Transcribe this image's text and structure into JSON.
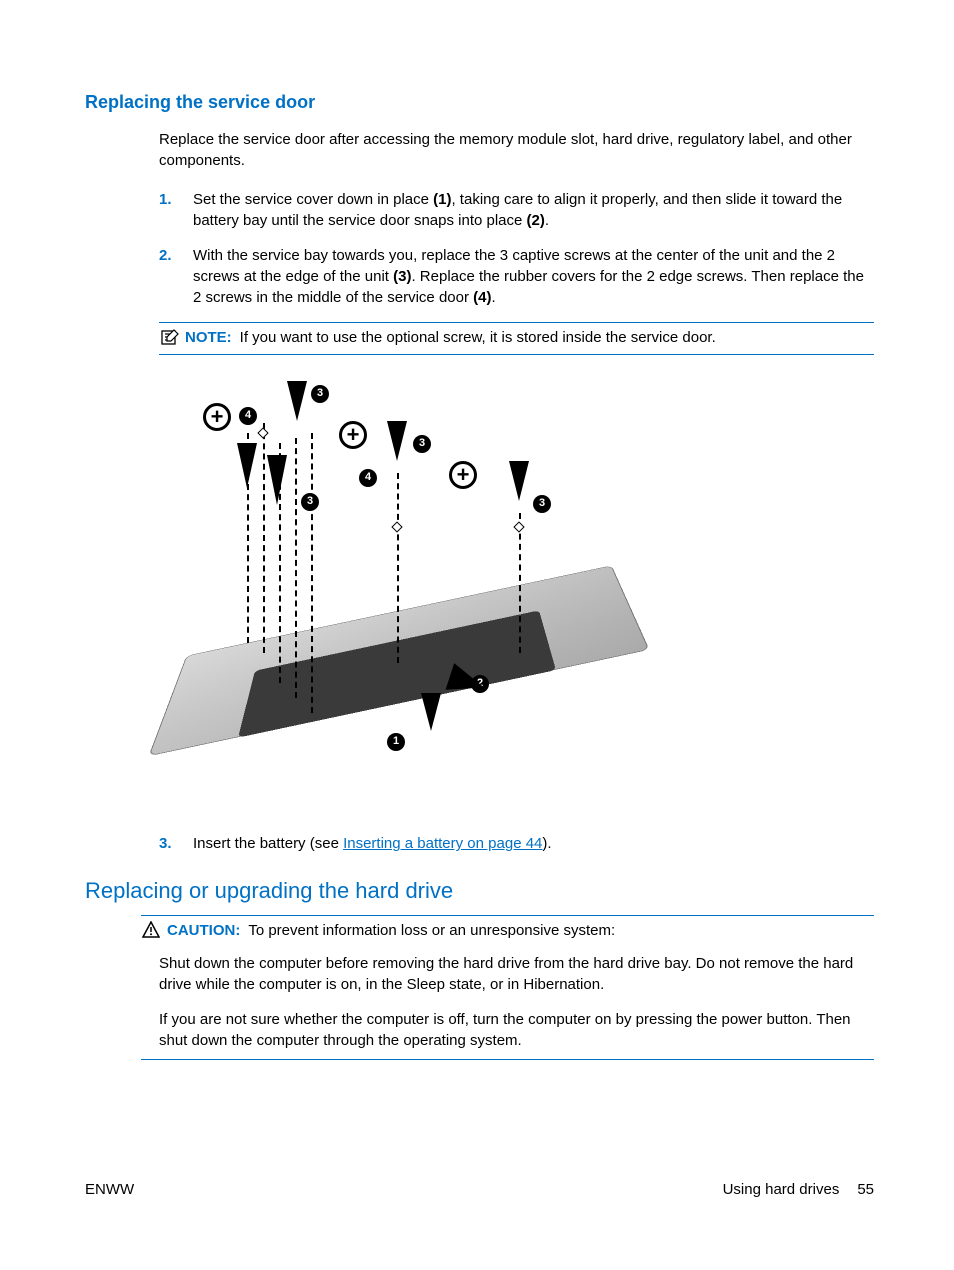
{
  "section1": {
    "heading": "Replacing the service door",
    "intro": "Replace the service door after accessing the memory module slot, hard drive, regulatory label, and other components.",
    "steps": [
      {
        "num": "1.",
        "text_a": "Set the service cover down in place ",
        "ref1": "(1)",
        "text_b": ", taking care to align it properly, and then slide it toward the battery bay until the service door snaps into place ",
        "ref2": "(2)",
        "text_c": "."
      },
      {
        "num": "2.",
        "text_a": "With the service bay towards you, replace the 3 captive screws at the center of the unit and the 2 screws at the edge of the unit ",
        "ref1": "(3)",
        "text_b": ". Replace the rubber covers for the 2 edge screws. Then replace the 2 screws in the middle of the service door ",
        "ref2": "(4)",
        "text_c": "."
      }
    ],
    "note_label": "NOTE:",
    "note_text": "If you want to use the optional screw, it is stored inside the service door.",
    "step3": {
      "num": "3.",
      "text_a": "Insert the battery (see ",
      "link": "Inserting a battery on page 44",
      "text_b": ")."
    }
  },
  "section2": {
    "heading": "Replacing or upgrading the hard drive",
    "caution_label": "CAUTION:",
    "caution_lead": "To prevent information loss or an unresponsive system:",
    "para1": "Shut down the computer before removing the hard drive from the hard drive bay. Do not remove the hard drive while the computer is on, in the Sleep state, or in Hibernation.",
    "para2": "If you are not sure whether the computer is off, turn the computer on by pressing the power button. Then shut down the computer through the operating system."
  },
  "callouts": {
    "c1": "1",
    "c2": "2",
    "c3": "3",
    "c4": "4"
  },
  "footer": {
    "left": "ENWW",
    "right_label": "Using hard drives",
    "page": "55"
  }
}
